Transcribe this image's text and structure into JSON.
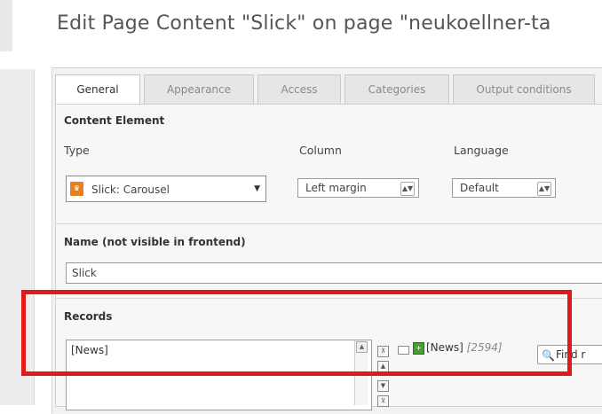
{
  "page_title": "Edit Page Content \"Slick\" on page \"neukoellner-ta",
  "tabs": [
    {
      "label": "General",
      "active": true
    },
    {
      "label": "Appearance",
      "active": false
    },
    {
      "label": "Access",
      "active": false
    },
    {
      "label": "Categories",
      "active": false
    },
    {
      "label": "Output conditions",
      "active": false
    }
  ],
  "content_element": {
    "heading": "Content Element",
    "type_label": "Type",
    "type_value": "Slick: Carousel",
    "column_label": "Column",
    "column_value": "Left margin",
    "language_label": "Language",
    "language_value": "Default"
  },
  "name_section": {
    "heading": "Name (not visible in frontend)",
    "value": "Slick"
  },
  "records_section": {
    "heading": "Records",
    "selected_items": [
      "[News]"
    ],
    "browse_label": "[News]",
    "browse_id": "[2594]",
    "find_button": "Find r"
  },
  "colors": {
    "highlight": "#e0191b",
    "type_icon": "#e8801c",
    "db_icon": "#4c9a3a"
  },
  "icons": {
    "type_icon": "content-plugin-icon",
    "folder_icon": "folder-icon",
    "db_icon": "database-icon",
    "find_icon": "magnifier-icon"
  }
}
